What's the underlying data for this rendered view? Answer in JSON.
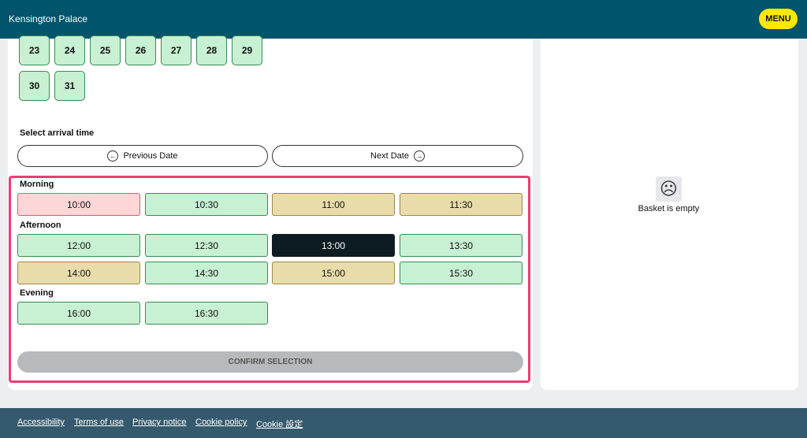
{
  "header": {
    "site_title": "Kensington Palace",
    "menu_label": "MENU"
  },
  "calendar": {
    "days_row1": [
      "23",
      "24",
      "25",
      "26",
      "27",
      "28",
      "29"
    ],
    "days_row2": [
      "30",
      "31"
    ]
  },
  "arrival": {
    "heading": "Select arrival time",
    "previous_label": "Previous Date",
    "next_label": "Next Date"
  },
  "slots": {
    "morning_label": "Morning",
    "morning": [
      {
        "time": "10:00",
        "status": "pink"
      },
      {
        "time": "10:30",
        "status": "green"
      },
      {
        "time": "11:00",
        "status": "tan"
      },
      {
        "time": "11:30",
        "status": "tan"
      }
    ],
    "afternoon_label": "Afternoon",
    "afternoon": [
      {
        "time": "12:00",
        "status": "green"
      },
      {
        "time": "12:30",
        "status": "green"
      },
      {
        "time": "13:00",
        "status": "selected"
      },
      {
        "time": "13:30",
        "status": "green"
      },
      {
        "time": "14:00",
        "status": "tan"
      },
      {
        "time": "14:30",
        "status": "green"
      },
      {
        "time": "15:00",
        "status": "tan"
      },
      {
        "time": "15:30",
        "status": "green"
      }
    ],
    "evening_label": "Evening",
    "evening": [
      {
        "time": "16:00",
        "status": "green"
      },
      {
        "time": "16:30",
        "status": "green"
      }
    ],
    "confirm_label": "CONFIRM SELECTION"
  },
  "basket": {
    "empty_text": "Basket is empty",
    "icon": "sad-face-icon"
  },
  "footer": {
    "links": [
      "Accessibility",
      "Terms of use",
      "Privacy notice",
      "Cookie policy",
      "Cookie 設定"
    ]
  },
  "colors": {
    "header": "#00546c",
    "menu": "#ffe800",
    "available": "#c8f0d2",
    "limited": "#e8dcaa",
    "soldout": "#fdd6d8",
    "selected": "#0d1b22",
    "highlight": "#ee3c72",
    "footer": "#365a6d"
  }
}
